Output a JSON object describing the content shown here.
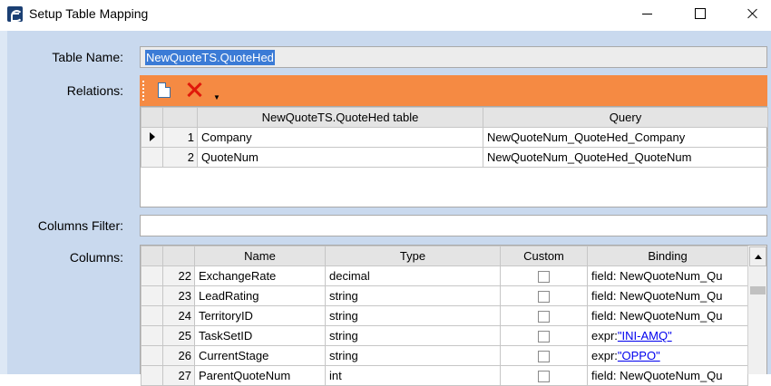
{
  "window": {
    "title": "Setup Table Mapping"
  },
  "form": {
    "table_name_label": "Table Name:",
    "table_name_value": "NewQuoteTS.QuoteHed",
    "relations_label": "Relations:",
    "columns_filter_label": "Columns Filter:",
    "columns_filter_value": "",
    "columns_label": "Columns:"
  },
  "toolbar": {
    "icons": [
      "new-document-icon",
      "delete-icon",
      "dropdown-arrow-icon"
    ],
    "accent_color": "#f58a43"
  },
  "relations": {
    "headers": [
      "NewQuoteTS.QuoteHed table",
      "Query"
    ],
    "rows": [
      {
        "num": "1",
        "table": "Company",
        "query": "NewQuoteNum_QuoteHed_Company"
      },
      {
        "num": "2",
        "table": "QuoteNum",
        "query": "NewQuoteNum_QuoteHed_QuoteNum"
      }
    ]
  },
  "columns": {
    "headers": [
      "Name",
      "Type",
      "Custom",
      "Binding"
    ],
    "rows": [
      {
        "num": "22",
        "name": "ExchangeRate",
        "type": "decimal",
        "binding_prefix": "field: NewQuoteNum_Qu",
        "binding_link": ""
      },
      {
        "num": "23",
        "name": "LeadRating",
        "type": "string",
        "binding_prefix": "field: NewQuoteNum_Qu",
        "binding_link": ""
      },
      {
        "num": "24",
        "name": "TerritoryID",
        "type": "string",
        "binding_prefix": "field: NewQuoteNum_Qu",
        "binding_link": ""
      },
      {
        "num": "25",
        "name": "TaskSetID",
        "type": "string",
        "binding_prefix": "expr:",
        "binding_link": "\"INI-AMQ\""
      },
      {
        "num": "26",
        "name": "CurrentStage",
        "type": "string",
        "binding_prefix": "expr:",
        "binding_link": "\"OPPO\""
      },
      {
        "num": "27",
        "name": "ParentQuoteNum",
        "type": "int",
        "binding_prefix": "field: NewQuoteNum_Qu",
        "binding_link": ""
      }
    ]
  }
}
